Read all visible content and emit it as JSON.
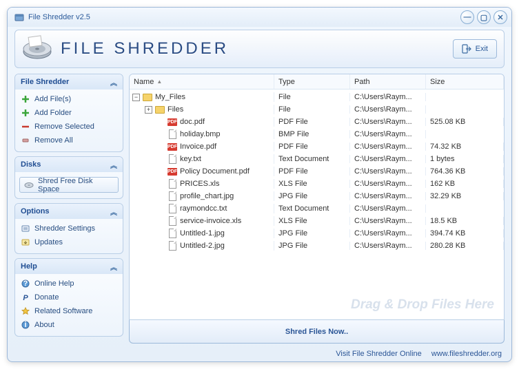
{
  "window": {
    "title": "File Shredder v2.5"
  },
  "header": {
    "appname": "FILE SHREDDER",
    "exit": "Exit"
  },
  "sidebar": {
    "shredder": {
      "title": "File Shredder",
      "items": [
        {
          "label": "Add File(s)",
          "icon": "plus-green-icon"
        },
        {
          "label": "Add Folder",
          "icon": "plus-green-icon"
        },
        {
          "label": "Remove Selected",
          "icon": "minus-red-icon"
        },
        {
          "label": "Remove All",
          "icon": "eraser-icon"
        }
      ]
    },
    "disks": {
      "title": "Disks",
      "button": "Shred Free Disk Space"
    },
    "options": {
      "title": "Options",
      "items": [
        {
          "label": "Shredder Settings",
          "icon": "settings-icon"
        },
        {
          "label": "Updates",
          "icon": "updates-icon"
        }
      ]
    },
    "help": {
      "title": "Help",
      "items": [
        {
          "label": "Online Help",
          "icon": "help-icon"
        },
        {
          "label": "Donate",
          "icon": "paypal-icon"
        },
        {
          "label": "Related Software",
          "icon": "star-icon"
        },
        {
          "label": "About",
          "icon": "info-icon"
        }
      ]
    }
  },
  "columns": {
    "name": "Name",
    "type": "Type",
    "path": "Path",
    "size": "Size"
  },
  "tree": [
    {
      "indent": 0,
      "expander": "−",
      "icon": "folder",
      "name": "My_Files",
      "type": "File",
      "path": "C:\\Users\\Raym...",
      "size": ""
    },
    {
      "indent": 1,
      "expander": "+",
      "icon": "folder",
      "name": "Files",
      "type": "File",
      "path": "C:\\Users\\Raym...",
      "size": ""
    },
    {
      "indent": 2,
      "icon": "pdf",
      "name": "doc.pdf",
      "type": "PDF File",
      "path": "C:\\Users\\Raym...",
      "size": "525.08 KB"
    },
    {
      "indent": 2,
      "icon": "file",
      "name": "holiday.bmp",
      "type": "BMP File",
      "path": "C:\\Users\\Raym...",
      "size": ""
    },
    {
      "indent": 2,
      "icon": "pdf",
      "name": "Invoice.pdf",
      "type": "PDF File",
      "path": "C:\\Users\\Raym...",
      "size": "74.32 KB"
    },
    {
      "indent": 2,
      "icon": "file",
      "name": "key.txt",
      "type": "Text Document",
      "path": "C:\\Users\\Raym...",
      "size": "1 bytes"
    },
    {
      "indent": 2,
      "icon": "pdf",
      "name": "Policy Document.pdf",
      "type": "PDF File",
      "path": "C:\\Users\\Raym...",
      "size": "764.36 KB"
    },
    {
      "indent": 2,
      "icon": "file",
      "name": "PRICES.xls",
      "type": "XLS File",
      "path": "C:\\Users\\Raym...",
      "size": "162 KB"
    },
    {
      "indent": 2,
      "icon": "file",
      "name": "profile_chart.jpg",
      "type": "JPG File",
      "path": "C:\\Users\\Raym...",
      "size": "32.29 KB"
    },
    {
      "indent": 2,
      "icon": "file",
      "name": "raymondcc.txt",
      "type": "Text Document",
      "path": "C:\\Users\\Raym...",
      "size": ""
    },
    {
      "indent": 2,
      "icon": "file",
      "name": "service-invoice.xls",
      "type": "XLS File",
      "path": "C:\\Users\\Raym...",
      "size": "18.5 KB"
    },
    {
      "indent": 2,
      "icon": "file",
      "name": "Untitled-1.jpg",
      "type": "JPG File",
      "path": "C:\\Users\\Raym...",
      "size": "394.74 KB"
    },
    {
      "indent": 2,
      "icon": "file",
      "name": "Untitled-2.jpg",
      "type": "JPG File",
      "path": "C:\\Users\\Raym...",
      "size": "280.28 KB"
    }
  ],
  "watermark": "Drag & Drop Files Here",
  "shred_button": "Shred Files Now..",
  "footer": {
    "text": "Visit File Shredder Online",
    "url": "www.fileshredder.org"
  }
}
